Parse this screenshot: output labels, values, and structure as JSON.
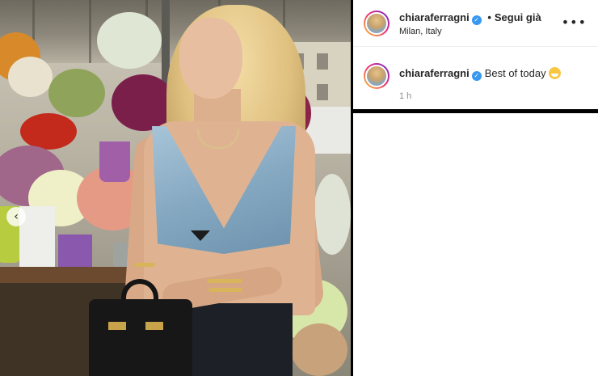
{
  "post": {
    "username": "chiaraferragni",
    "follow_status": "Segui già",
    "dot_separator": "•",
    "location": "Milan, Italy",
    "more_label": "•••"
  },
  "comment": {
    "username": "chiaraferragni",
    "caption": "Best of today",
    "timestamp": "1 h"
  },
  "carousel": {
    "prev_label": "‹"
  },
  "icons": {
    "verified": "verified-badge-icon",
    "more": "more-options-icon",
    "emoji": "grinning-sweat-emoji-icon",
    "prev": "chevron-left-icon"
  },
  "colors": {
    "verified_blue": "#3897f0",
    "text_primary": "#262626",
    "text_secondary": "#8e8e8e",
    "panel_border": "#000000"
  }
}
